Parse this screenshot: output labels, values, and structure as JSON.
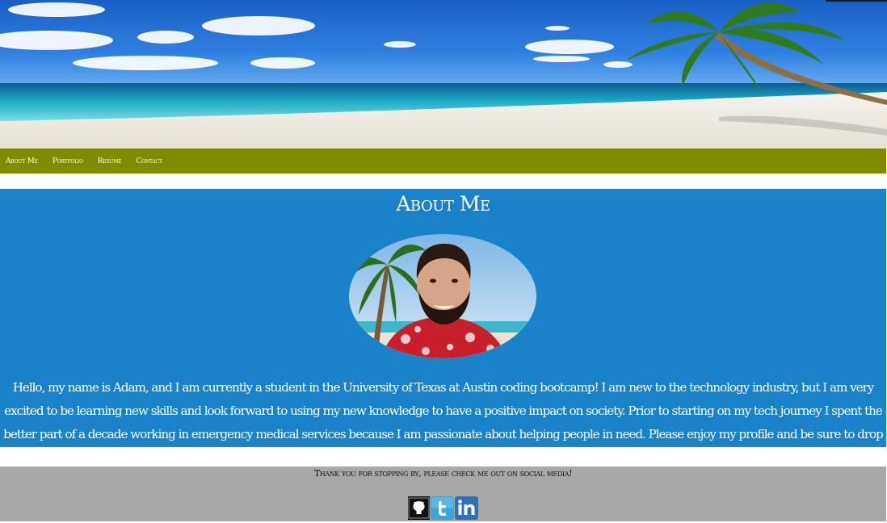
{
  "nav": {
    "items": [
      {
        "label": "About Me"
      },
      {
        "label": "Portfolio"
      },
      {
        "label": "Resume"
      },
      {
        "label": "Contact"
      }
    ]
  },
  "about": {
    "title": "About Me",
    "bio": "Hello, my name is Adam, and I am currently a student in the University of Texas at Austin coding bootcamp! I am new to the technology industry, but I am very excited to be learning new skills and look forward to using my new knowledge to have a positive impact on society. Prior to starting on my tech journey I spent the better part of a decade working in emergency medical services because I am passionate about helping people in need. Please enjoy my profile and be sure to drop me a line using the contact section."
  },
  "footer": {
    "text": "Thank you for stopping by, please check me out on social media!",
    "social": [
      {
        "icon": "github-icon",
        "color": "#000000"
      },
      {
        "icon": "twitter-icon",
        "color": "#3aa3d8"
      },
      {
        "icon": "linkedin-icon",
        "color": "#2f6fb8"
      }
    ]
  },
  "colors": {
    "nav_bg": "#7f8c00",
    "about_bg": "#1a82c8",
    "footer_bg": "#a8a8a8"
  }
}
